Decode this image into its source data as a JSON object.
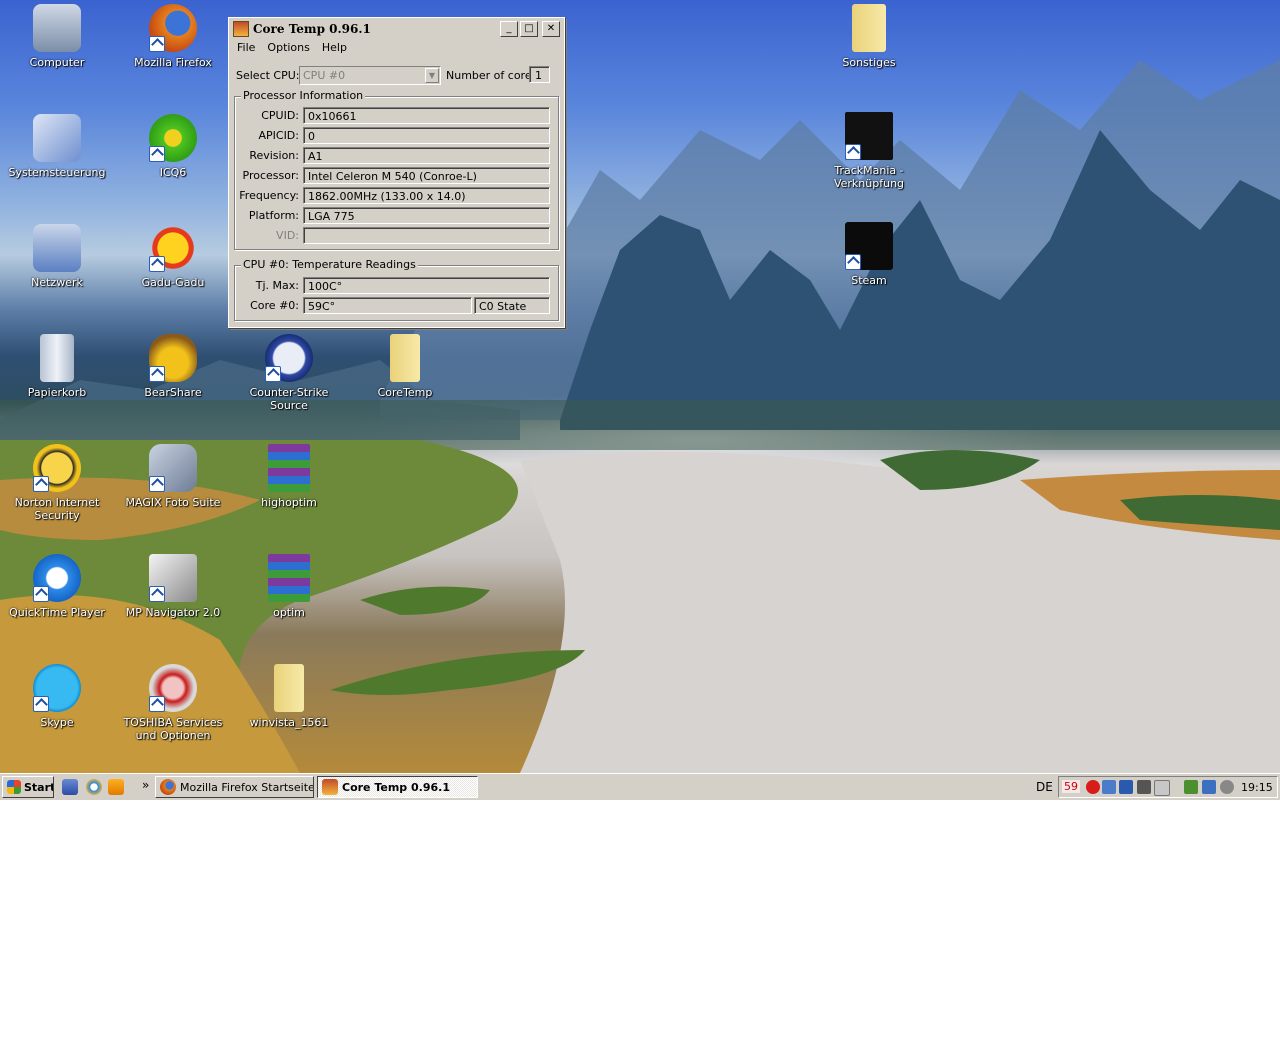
{
  "desktop": {
    "icons": [
      {
        "label": "Computer",
        "icon": "computer-icon",
        "shortcut": false
      },
      {
        "label": "Mozilla Firefox",
        "icon": "firefox-icon",
        "shortcut": true
      },
      {
        "label": "Sonstiges",
        "icon": "folder-icon",
        "shortcut": false
      },
      {
        "label": "Systemsteuerung",
        "icon": "control-panel-icon",
        "shortcut": false
      },
      {
        "label": "ICQ6",
        "icon": "icq-flower-icon",
        "shortcut": true
      },
      {
        "label": "TrackMania - Verknüpfung",
        "icon": "trackmania-icon",
        "shortcut": true
      },
      {
        "label": "Netzwerk",
        "icon": "network-icon",
        "shortcut": false
      },
      {
        "label": "Gadu-Gadu",
        "icon": "gadu-gadu-sun-icon",
        "shortcut": true
      },
      {
        "label": "Steam",
        "icon": "steam-icon",
        "shortcut": true
      },
      {
        "label": "Papierkorb",
        "icon": "recycle-bin-icon",
        "shortcut": false
      },
      {
        "label": "BearShare",
        "icon": "bearshare-icon",
        "shortcut": true
      },
      {
        "label": "Counter-Strike Source",
        "icon": "counter-strike-icon",
        "shortcut": true
      },
      {
        "label": "CoreTemp",
        "icon": "folder-icon",
        "shortcut": false
      },
      {
        "label": "Norton Internet Security",
        "icon": "norton-icon",
        "shortcut": true
      },
      {
        "label": "MAGIX Foto Suite",
        "icon": "magix-icon",
        "shortcut": true
      },
      {
        "label": "highoptim",
        "icon": "winrar-archive-icon",
        "shortcut": false
      },
      {
        "label": "QuickTime Player",
        "icon": "quicktime-icon",
        "shortcut": true
      },
      {
        "label": "MP Navigator 2.0",
        "icon": "mp-navigator-icon",
        "shortcut": true
      },
      {
        "label": "optim",
        "icon": "winrar-archive-icon",
        "shortcut": false
      },
      {
        "label": "Skype",
        "icon": "skype-icon",
        "shortcut": true
      },
      {
        "label": "TOSHIBA Services und Optionen",
        "icon": "toshiba-icon",
        "shortcut": true
      },
      {
        "label": "winvista_1561",
        "icon": "folder-icon",
        "shortcut": false
      }
    ]
  },
  "window": {
    "title": "Core Temp 0.96.1",
    "buttons": {
      "minimize": "_",
      "maximize": "□",
      "close": "✕"
    },
    "menu": [
      "File",
      "Options",
      "Help"
    ],
    "select_cpu_label": "Select CPU:",
    "select_cpu_value": "CPU #0",
    "cores_label": "Number of cores",
    "cores_value": "1",
    "processor_group_title": "Processor Information",
    "processor_rows": [
      {
        "label": "CPUID:",
        "value": "0x10661"
      },
      {
        "label": "APICID:",
        "value": "0"
      },
      {
        "label": "Revision:",
        "value": "A1"
      },
      {
        "label": "Processor:",
        "value": "Intel Celeron M 540 (Conroe-L)"
      },
      {
        "label": "Frequency:",
        "value": "1862.00MHz (133.00 x 14.0)"
      },
      {
        "label": "Platform:",
        "value": "LGA 775"
      },
      {
        "label": "VID:",
        "value": ""
      }
    ],
    "temp_group_title": "CPU #0: Temperature Readings",
    "tj_max_label": "Tj. Max:",
    "tj_max_value": "100C°",
    "core0_label": "Core #0:",
    "core0_value": "59C°",
    "core0_state": "C0 State"
  },
  "taskbar": {
    "start_label": "Start",
    "quicklaunch": [
      "show-desktop-icon",
      "internet-explorer-icon",
      "media-player-icon"
    ],
    "overflow": "»",
    "tasks": [
      {
        "label": "Mozilla Firefox Startseite...",
        "icon": "firefox-icon",
        "active": false
      },
      {
        "label": "Core Temp 0.96.1",
        "icon": "coretemp-icon",
        "active": true
      }
    ],
    "language": "DE",
    "tray_temp": "59",
    "clock": "19:15"
  },
  "colors": {
    "desktop_sky": "#3b63d0",
    "window_face": "#d4d0c8",
    "tray_temp": "#d40000"
  }
}
